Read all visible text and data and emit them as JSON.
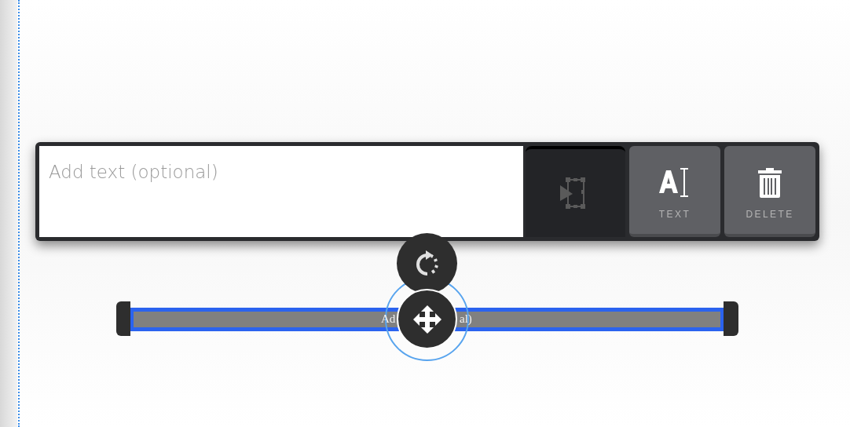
{
  "editor": {
    "placeholder": "Add text (optional)"
  },
  "tools": [
    {
      "kind": "select",
      "selected": true
    },
    {
      "kind": "text",
      "label": "TEXT",
      "selected": false
    },
    {
      "kind": "delete",
      "label": "DELETE",
      "selected": false
    }
  ],
  "annotation": {
    "text_fragments": [
      "Ad",
      "al)"
    ]
  }
}
